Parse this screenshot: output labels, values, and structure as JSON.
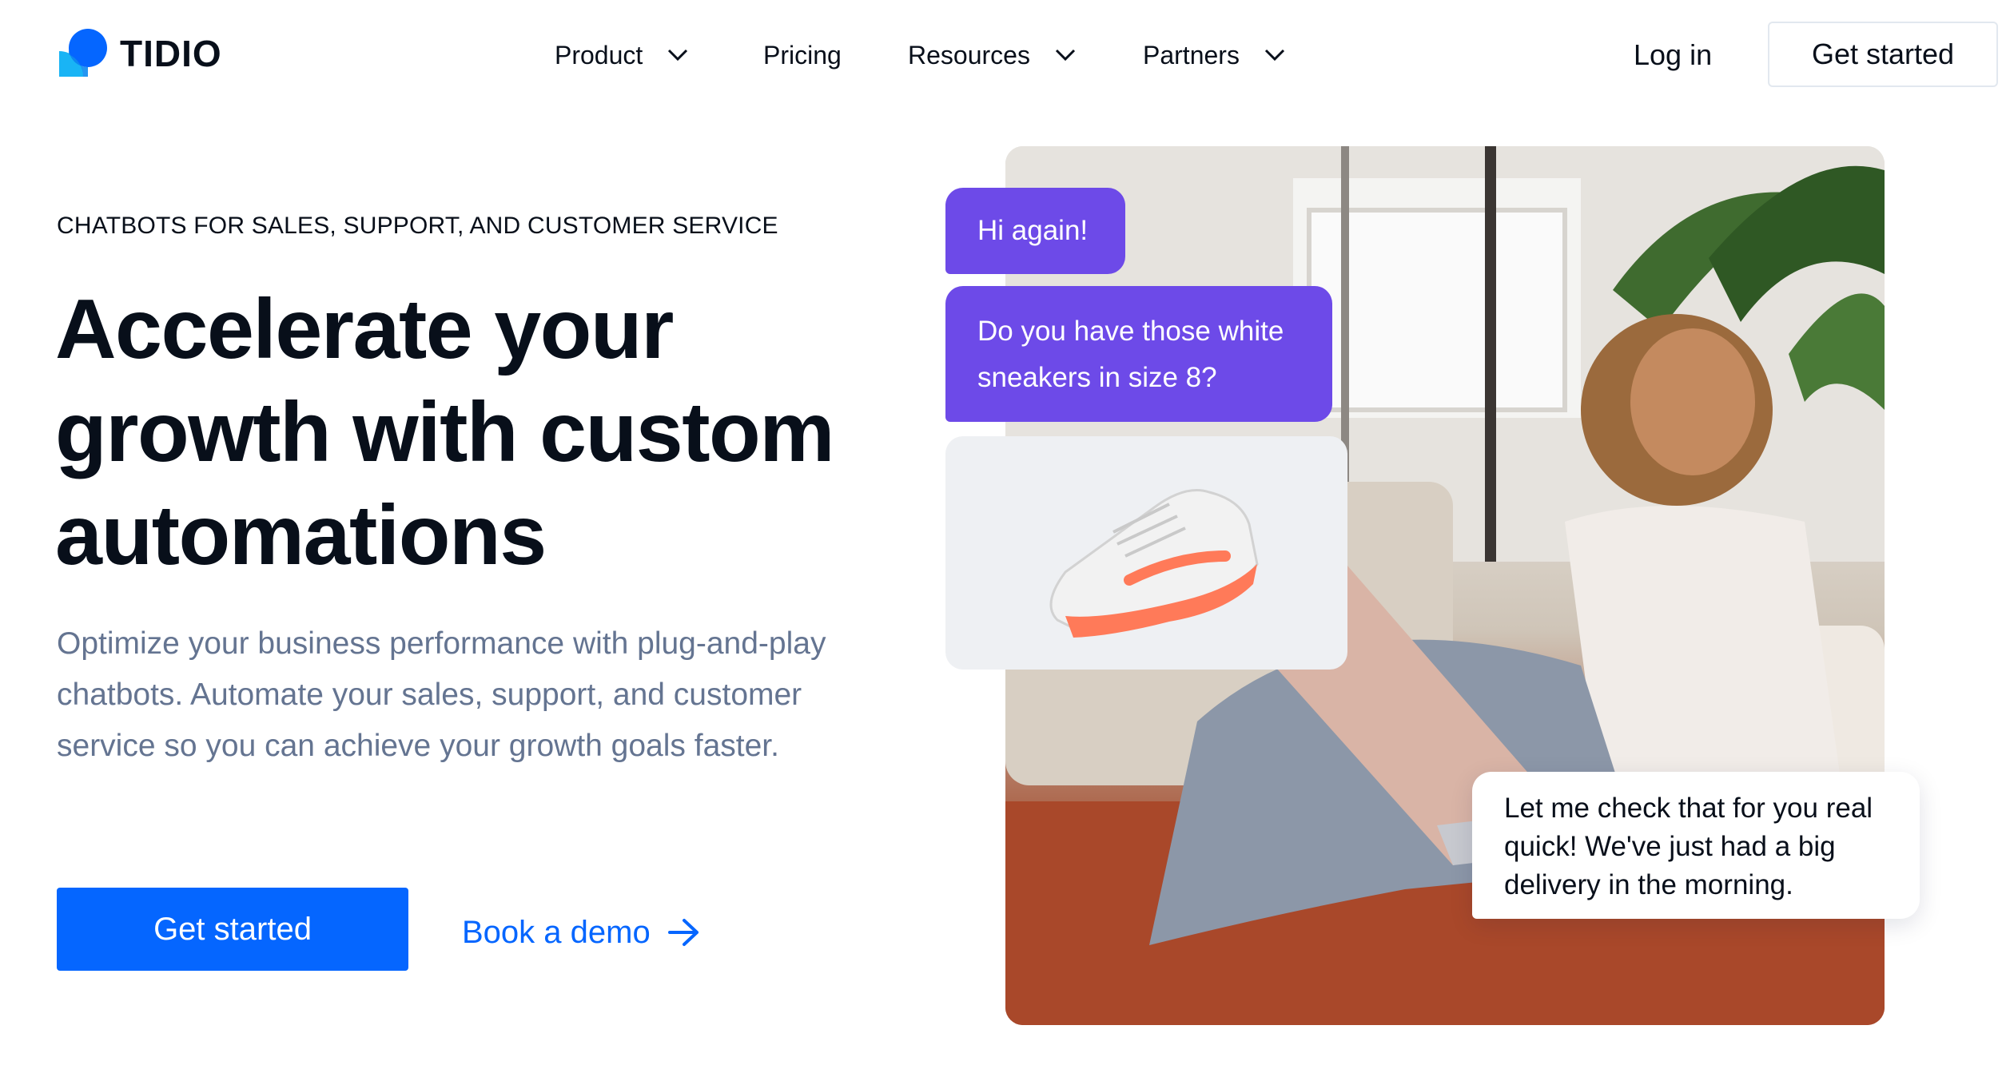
{
  "brand": {
    "name": "TIDIO"
  },
  "nav": {
    "items": [
      {
        "label": "Product",
        "has_dropdown": true
      },
      {
        "label": "Pricing",
        "has_dropdown": false
      },
      {
        "label": "Resources",
        "has_dropdown": true
      },
      {
        "label": "Partners",
        "has_dropdown": true
      }
    ],
    "login_label": "Log in",
    "cta_label": "Get started"
  },
  "hero": {
    "eyebrow": "CHATBOTS FOR SALES, SUPPORT, AND CUSTOMER SERVICE",
    "headline_line1": "Accelerate your",
    "headline_line2": "growth with custom",
    "headline_line3": "automations",
    "subcopy": "Optimize your business performance with plug-and-play chatbots. Automate your sales, support, and customer service so you can achieve your growth goals faster.",
    "primary_cta": "Get started",
    "secondary_cta": "Book a demo"
  },
  "chat": {
    "message1": "Hi again!",
    "message2": "Do you have those white sneakers in size 8?",
    "reply": "Let me check that for you real quick! We've just had a big delivery in the morning."
  },
  "colors": {
    "accent": "#0566FF",
    "text": "#080F1A",
    "muted": "#647491",
    "bubble": "#6D4AE8"
  }
}
